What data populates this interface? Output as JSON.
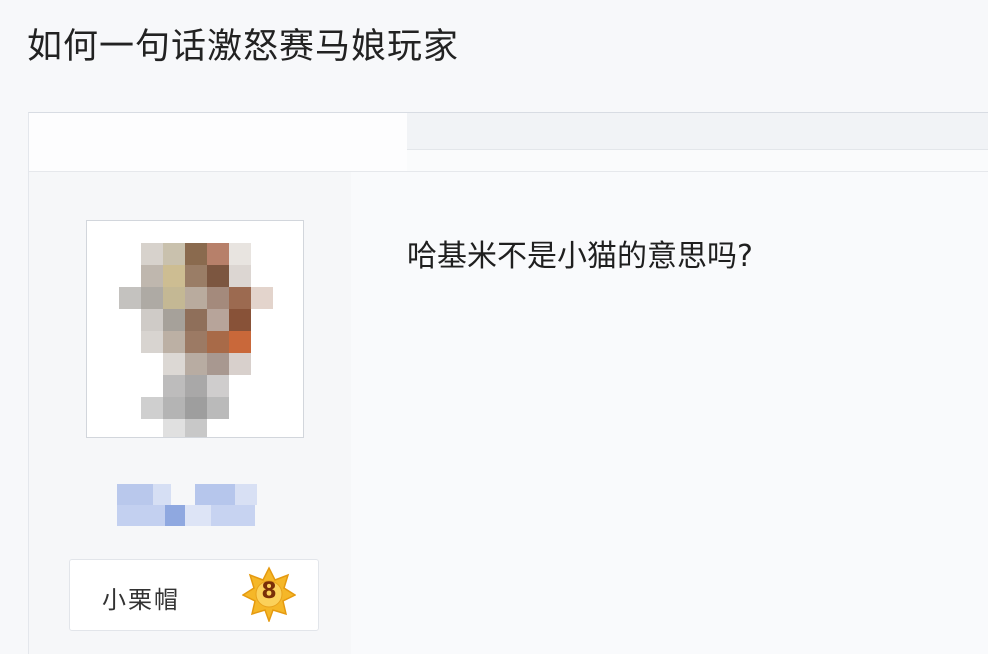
{
  "thread": {
    "title": "如何一句话激怒赛马娘玩家"
  },
  "post": {
    "content": "哈基米不是小猫的意思吗?",
    "author": {
      "badge_name": "小栗帽",
      "level": "8",
      "level_badge_color": "#f5b728"
    }
  },
  "colors": {
    "page_background": "#f7f8fa",
    "title_text": "#222222",
    "content_text": "#1f1f1f"
  }
}
